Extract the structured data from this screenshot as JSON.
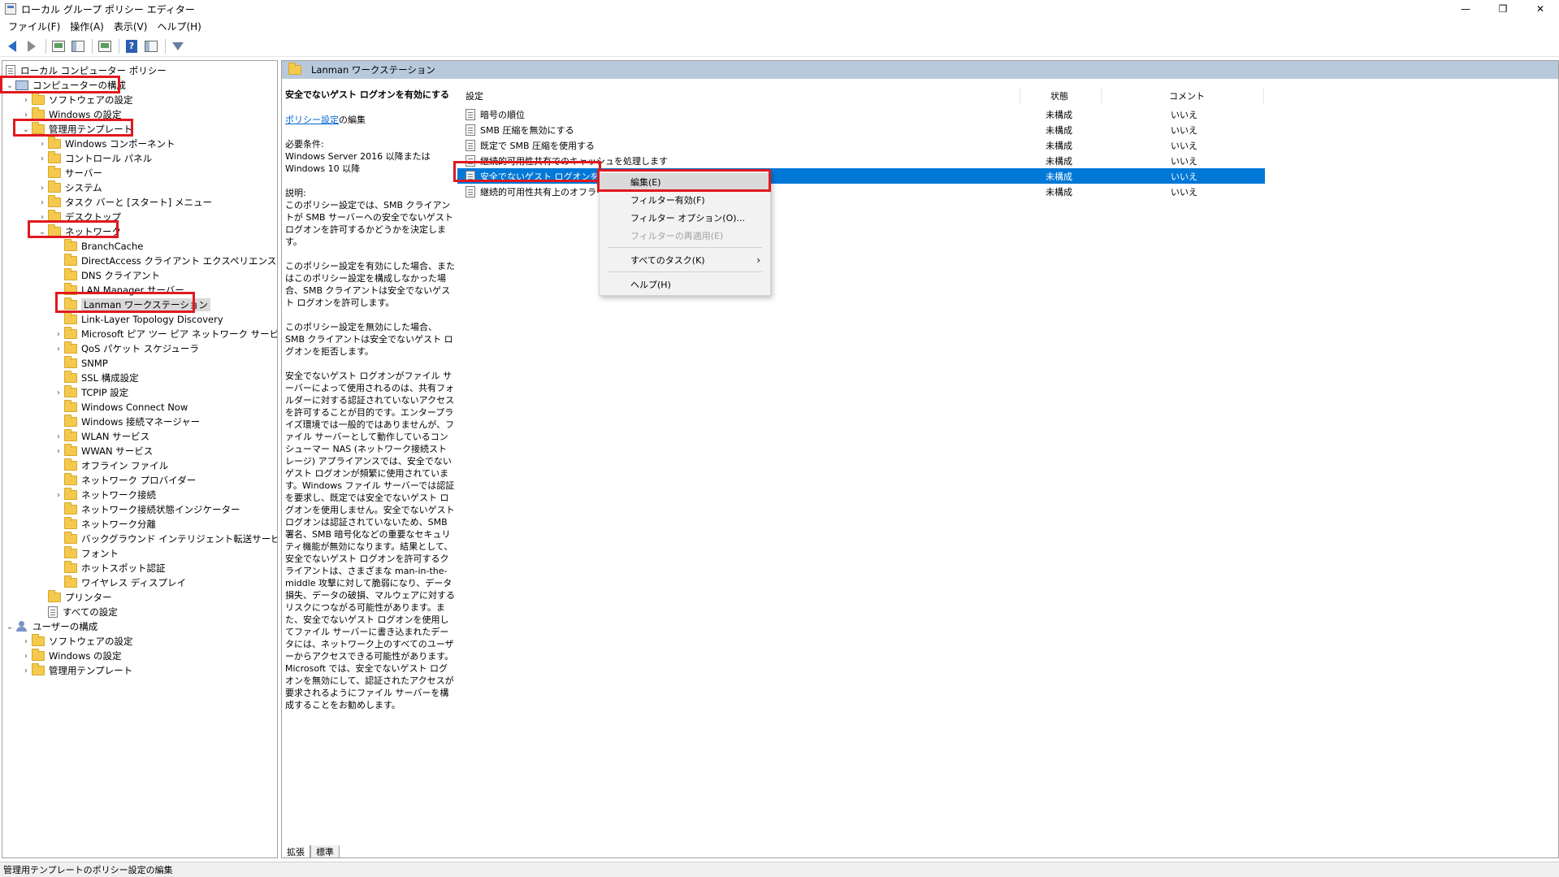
{
  "window": {
    "title": "ローカル グループ ポリシー エディター",
    "minimize": "—",
    "maximize": "❐",
    "close": "✕"
  },
  "menu": [
    "ファイル(F)",
    "操作(A)",
    "表示(V)",
    "ヘルプ(H)"
  ],
  "toolbar": {
    "back": "back-arrow-icon",
    "forward": "forward-arrow-icon",
    "help_glyph": "?"
  },
  "tree": {
    "root": "ローカル コンピューター ポリシー",
    "computer_config": "コンピューターの構成",
    "cc_software": "ソフトウェアの設定",
    "cc_windows": "Windows の設定",
    "cc_admin": "管理用テンプレート",
    "cc_admin_children": [
      "Windows コンポーネント",
      "コントロール パネル",
      "サーバー",
      "システム",
      "タスク バーと [スタート] メニュー",
      "デスクトップ"
    ],
    "network": "ネットワーク",
    "network_children": [
      "BranchCache",
      "DirectAccess クライアント エクスペリエンスの設定",
      "DNS クライアント",
      "LAN Manager サーバー"
    ],
    "lanman": "Lanman ワークステーション",
    "network_children2": [
      "Link-Layer Topology Discovery",
      "Microsoft ピア ツー ピア ネットワーク サービス",
      "QoS パケット スケジューラ",
      "SNMP",
      "SSL 構成設定",
      "TCPIP 設定",
      "Windows Connect Now",
      "Windows 接続マネージャー",
      "WLAN サービス",
      "WWAN サービス",
      "オフライン ファイル",
      "ネットワーク プロバイダー",
      "ネットワーク接続",
      "ネットワーク接続状態インジケーター",
      "ネットワーク分離",
      "バックグラウンド インテリジェント転送サービス (BITS)",
      "フォント",
      "ホットスポット認証",
      "ワイヤレス ディスプレイ"
    ],
    "printer": "プリンター",
    "all_settings": "すべての設定",
    "user_config": "ユーザーの構成",
    "uc_software": "ソフトウェアの設定",
    "uc_windows": "Windows の設定",
    "uc_admin": "管理用テンプレート"
  },
  "right": {
    "header": "Lanman ワークステーション",
    "desc_title": "安全でないゲスト ログオンを有効にする",
    "desc_link": "ポリシー設定",
    "desc_link_suffix": "の編集",
    "req_label": "必要条件:",
    "req_text": "Windows Server 2016 以降または Windows 10 以降",
    "explain_label": "説明:",
    "para1": "このポリシー設定では、SMB クライアントが SMB サーバーへの安全でないゲスト ログオンを許可するかどうかを決定します。",
    "para2": "このポリシー設定を有効にした場合、またはこのポリシー設定を構成しなかった場合、SMB クライアントは安全でないゲスト ログオンを許可します。",
    "para3": "このポリシー設定を無効にした場合、SMB クライアントは安全でないゲスト ログオンを拒否します。",
    "para4": "安全でないゲスト ログオンがファイル サーバーによって使用されるのは、共有フォルダーに対する認証されていないアクセスを許可することが目的です。エンタープライズ環境では一般的ではありませんが、ファイル サーバーとして動作しているコンシューマー NAS (ネットワーク接続ストレージ) アプライアンスでは、安全でないゲスト ログオンが頻繁に使用されています。Windows ファイル サーバーでは認証を要求し、既定では安全でないゲスト ログオンを使用しません。安全でないゲスト ログオンは認証されていないため、SMB 署名、SMB 暗号化などの重要なセキュリティ機能が無効になります。結果として、安全でないゲスト ログオンを許可するクライアントは、さまざまな man-in-the-middle 攻撃に対して脆弱になり、データ損失、データの破損、マルウェアに対するリスクにつながる可能性があります。また、安全でないゲスト ログオンを使用してファイル サーバーに書き込まれたデータには、ネットワーク上のすべてのユーザーからアクセスできる可能性があります。Microsoft では、安全でないゲスト ログオンを無効にして、認証されたアクセスが要求されるようにファイル サーバーを構成することをお勧めします。",
    "columns": {
      "setting": "設定",
      "state": "状態",
      "comment": "コメント"
    },
    "rows": [
      {
        "name": "暗号の順位",
        "state": "未構成",
        "comment": "いいえ"
      },
      {
        "name": "SMB 圧縮を無効にする",
        "state": "未構成",
        "comment": "いいえ"
      },
      {
        "name": "既定で SMB 圧縮を使用する",
        "state": "未構成",
        "comment": "いいえ"
      },
      {
        "name": "継続的可用性共有でのキャッシュを処理します",
        "state": "未構成",
        "comment": "いいえ"
      },
      {
        "name": "安全でないゲスト ログオンを有効",
        "state": "未構成",
        "comment": "いいえ"
      },
      {
        "name": "継続的可用性共有上のオフライ",
        "state": "未構成",
        "comment": "いいえ"
      }
    ]
  },
  "context_menu": {
    "edit": "編集(E)",
    "filter_on": "フィルター有効(F)",
    "filter_options": "フィルター オプション(O)...",
    "filter_reapply": "フィルターの再適用(E)",
    "all_tasks": "すべてのタスク(K)",
    "help": "ヘルプ(H)",
    "submenu_arrow": "›"
  },
  "tabs": [
    "拡張",
    "標準"
  ],
  "status": "管理用テンプレートのポリシー設定の編集",
  "colors": {
    "highlight": "#0078d7",
    "annotation": "#e0191f",
    "header_band": "#b9c9dc"
  }
}
